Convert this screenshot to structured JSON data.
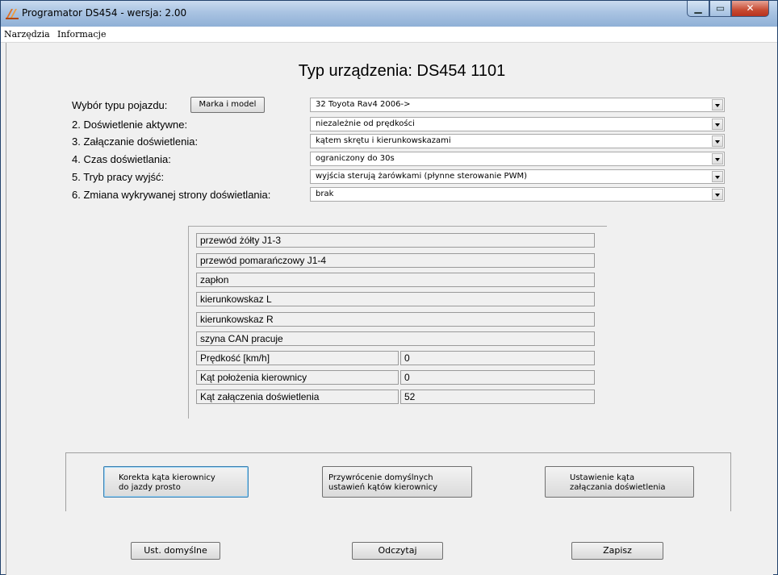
{
  "window": {
    "title": "Programator DS454 - wersja:  2.00",
    "min_glyph": "▁",
    "max_glyph": "▭",
    "close_glyph": "✕"
  },
  "menu": [
    "Narzędzia",
    "Informacje"
  ],
  "device_heading": "Typ urządzenia:  DS454 1101",
  "vehicle_button": "Marka i model",
  "settings": [
    {
      "label": "Wybór typu pojazdu:",
      "value": "32 Toyota Rav4 2006->"
    },
    {
      "label": "2. Doświetlenie aktywne:",
      "value": "niezależnie od prędkości"
    },
    {
      "label": "3. Załączanie doświetlenia:",
      "value": "kątem skrętu i kierunkowskazami"
    },
    {
      "label": "4. Czas doświetlania:",
      "value": "ograniczony do 30s"
    },
    {
      "label": "5. Tryb pracy wyjść:",
      "value": "wyjścia sterują żarówkami (płynne sterowanie PWM)"
    },
    {
      "label": "6. Zmiana wykrywanej strony doświetlania:",
      "value": "brak"
    }
  ],
  "status_rows": [
    "przewód żółty J1-3",
    "przewód pomarańczowy J1-4",
    "zapłon",
    "kierunkowskaz L",
    "kierunkowskaz R",
    "szyna CAN pracuje"
  ],
  "readings": [
    {
      "label": "Prędkość [km/h]",
      "value": "0"
    },
    {
      "label": "Kąt położenia kierownicy",
      "value": "0"
    },
    {
      "label": "Kąt załączenia doświetlenia",
      "value": "52"
    }
  ],
  "calibration_buttons": [
    {
      "line1": "Korekta kąta kierownicy",
      "line2": "do jazdy prosto"
    },
    {
      "line1": "Przywrócenie domyślnych",
      "line2": "ustawień kątów kierownicy"
    },
    {
      "line1": "Ustawienie kąta",
      "line2": "załączania doświetlenia"
    }
  ],
  "bottom_buttons": {
    "defaults": "Ust. domyślne",
    "read": "Odczytaj",
    "save": "Zapisz"
  },
  "colors": {
    "titlebar": "#a9c3e2",
    "close": "#c74b33",
    "window_bg": "#f0f0f0"
  }
}
